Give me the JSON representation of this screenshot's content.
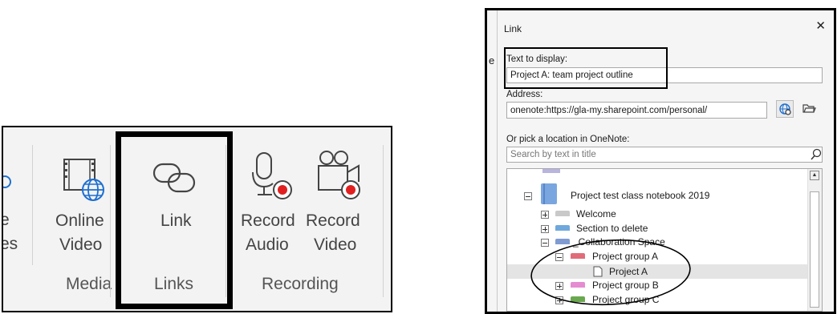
{
  "ribbon": {
    "partial_left_top": "e",
    "partial_left_bottom": "es",
    "buttons": [
      {
        "id": "online-video",
        "line1": "Online",
        "line2": "Video"
      },
      {
        "id": "link",
        "line1": "Link"
      },
      {
        "id": "record-audio",
        "line1": "Record",
        "line2": "Audio"
      },
      {
        "id": "record-video",
        "line1": "Record",
        "line2": "Video"
      }
    ],
    "groups": {
      "media": "Media",
      "links": "Links",
      "recording": "Recording"
    }
  },
  "dialog": {
    "title": "Link",
    "close_glyph": "✕",
    "left_fragment": "e",
    "text_to_display_label": "Text to display:",
    "text_to_display_value": "Project A: team project outline",
    "address_label": "Address:",
    "address_value": "onenote:https://gla-my.sharepoint.com/personal/",
    "pick_location_label": "Or pick a location in OneNote:",
    "search_placeholder": "Search by text in title",
    "tree": {
      "notebook": "Project test class notebook 2019",
      "items": [
        {
          "label": "Welcome",
          "color": "#c9c9c9",
          "expander": "plus"
        },
        {
          "label": "Section to delete",
          "color": "#6fa8dc",
          "expander": "plus"
        },
        {
          "label": "_Collaboration Space",
          "color": "#7f9bd1",
          "expander": "minus"
        },
        {
          "label": "Project group A",
          "color": "#e06c7a",
          "expander": "minus"
        },
        {
          "label": "Project A",
          "page": true
        },
        {
          "label": "Project group B",
          "color": "#e58bd2",
          "expander": "plus"
        },
        {
          "label": "Project group C",
          "color": "#6aa84f",
          "expander": "plus"
        }
      ]
    }
  },
  "colors": {
    "record_dot": "#e02020",
    "globe_blue": "#1e6fd0",
    "notebook_blue": "#7aa6e0",
    "selection": "#e4e4e4"
  }
}
